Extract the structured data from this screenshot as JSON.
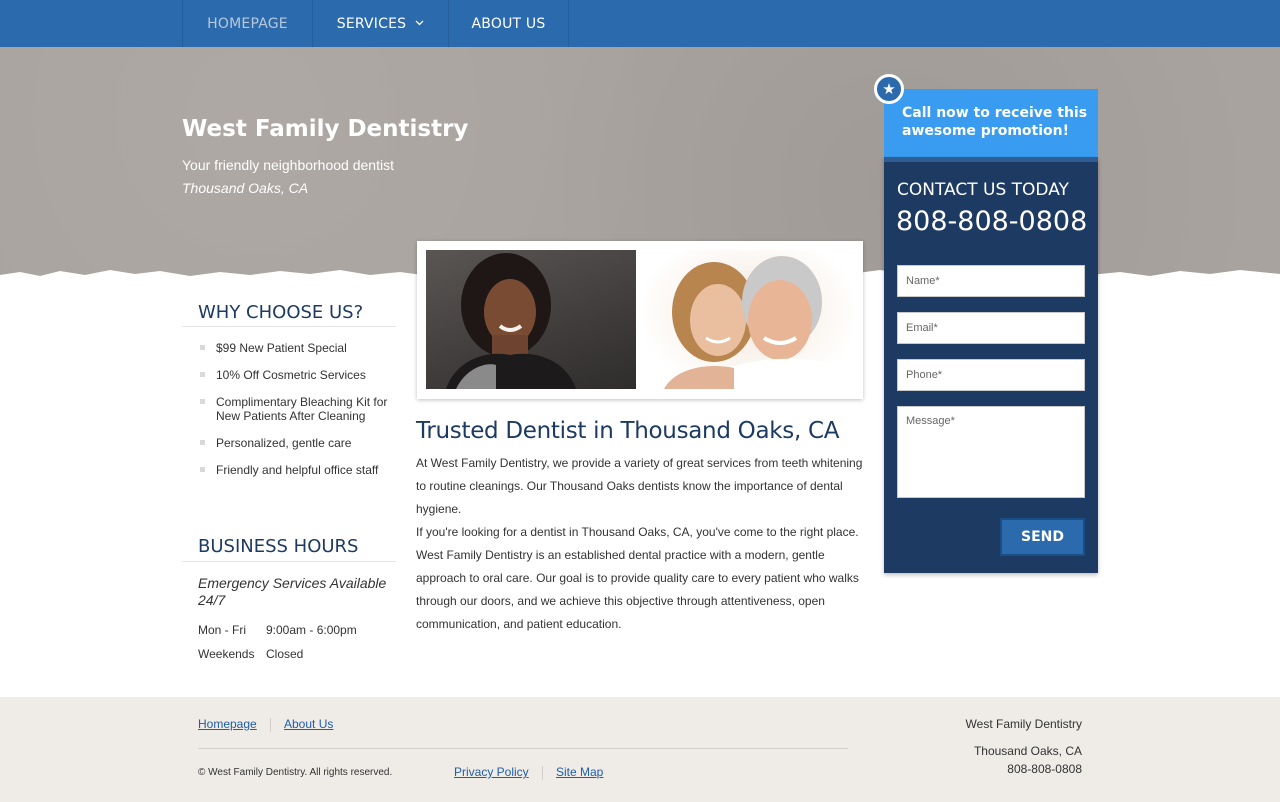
{
  "nav": {
    "items": [
      {
        "label": "HOMEPAGE",
        "active": true
      },
      {
        "label": "SERVICES",
        "has_dropdown": true
      },
      {
        "label": "ABOUT US"
      }
    ]
  },
  "hero": {
    "title": "West Family Dentistry",
    "tagline": "Your friendly neighborhood dentist",
    "location": "Thousand Oaks, CA"
  },
  "why": {
    "heading": "WHY CHOOSE US?",
    "items": [
      "$99 New Patient Special",
      "10% Off Cosmetric Services",
      "Complimentary Bleaching Kit for New Patients After Cleaning",
      "Personalized, gentle care",
      "Friendly and helpful office staff"
    ]
  },
  "hours": {
    "heading": "BUSINESS HOURS",
    "emergency": "Emergency Services Available 24/7",
    "rows": [
      {
        "day": "Mon - Fri",
        "time": "9:00am - 6:00pm"
      },
      {
        "day": "Weekends",
        "time": "Closed"
      }
    ]
  },
  "main": {
    "title": "Trusted Dentist in Thousand Oaks, CA",
    "para1": "At West Family Dentistry, we provide a variety of great services from teeth whitening to routine cleanings. Our Thousand Oaks dentists know the importance of dental hygiene.",
    "para2": "If you're looking for a dentist in Thousand Oaks, CA, you've come to the right place. West Family Dentistry is an established dental practice with a modern, gentle approach to oral care. Our goal is to provide quality care to every patient who walks through our doors, and we achieve this objective through attentiveness, open communication, and patient education."
  },
  "contact": {
    "promo": "Call now to receive this awesome promotion!",
    "heading": "CONTACT US TODAY",
    "phone": "808-808-0808",
    "name_placeholder": "Name*",
    "email_placeholder": "Email*",
    "phone_placeholder": "Phone*",
    "message_placeholder": "Message*",
    "send_label": "SEND"
  },
  "footer": {
    "links_top": [
      "Homepage",
      "About Us"
    ],
    "copyright": "© West Family Dentistry. All rights reserved.",
    "links_bottom": [
      "Privacy Policy",
      "Site Map"
    ],
    "address_name": "West Family Dentistry",
    "address_city": "Thousand Oaks, CA",
    "address_phone": "808-808-0808"
  },
  "colors": {
    "nav": "#2a6aad",
    "hero": "#a9a39f",
    "heading": "#1d3a62",
    "promo": "#3a9cf0",
    "panel": "#1d3a62",
    "footer": "#efebe7",
    "link": "#1f5ea8"
  }
}
